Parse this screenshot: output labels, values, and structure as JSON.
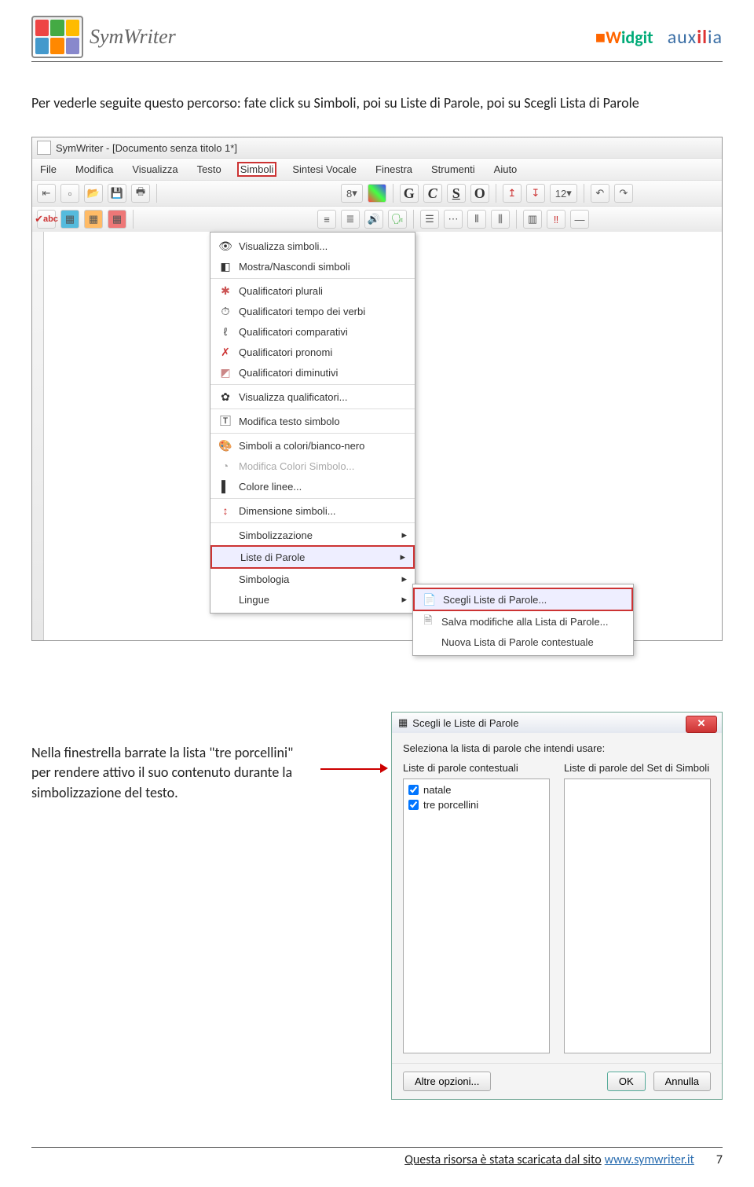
{
  "header": {
    "product_name": "SymWriter",
    "brand1_a": "W",
    "brand1_b": "idgit",
    "brand2_pre": "aux",
    "brand2_il": "il",
    "brand2_post": "ia"
  },
  "intro_text": "Per vederle seguite questo percorso: fate click su Simboli, poi su Liste di Parole, poi su Scegli Lista di Parole",
  "app": {
    "title": "SymWriter - [Documento senza titolo 1*]",
    "menus": {
      "file": "File",
      "modifica": "Modifica",
      "visualizza": "Visualizza",
      "testo": "Testo",
      "simboli": "Simboli",
      "sintesi": "Sintesi Vocale",
      "finestra": "Finestra",
      "strumenti": "Strumenti",
      "aiuto": "Aiuto"
    },
    "toolbar": {
      "fontsize": "8",
      "g": "G",
      "c": "C",
      "s": "S",
      "o": "O",
      "twelve": "12"
    },
    "dropdown": {
      "vis_simboli": "Visualizza simboli...",
      "mostra": "Mostra/Nascondi simboli",
      "plurali": "Qualificatori plurali",
      "tempo": "Qualificatori tempo dei verbi",
      "comparativi": "Qualificatori comparativi",
      "pronomi": "Qualificatori pronomi",
      "diminutivi": "Qualificatori diminutivi",
      "vis_qual": "Visualizza qualificatori...",
      "mod_testo": "Modifica testo simbolo",
      "colori_bn": "Simboli a colori/bianco-nero",
      "mod_colori": "Modifica Colori Simbolo...",
      "colore_linee": "Colore linee...",
      "dim_simboli": "Dimensione simboli...",
      "simbolizzazione": "Simbolizzazione",
      "liste_parole": "Liste di Parole",
      "simbologia": "Simbologia",
      "lingue": "Lingue"
    },
    "submenu": {
      "scegli": "Scegli Liste di Parole...",
      "salva": "Salva modifiche alla Lista di Parole...",
      "nuova": "Nuova Lista di Parole contestuale"
    }
  },
  "para2": "Nella finestrella barrate la lista \"tre porcellini\" per rendere attivo il suo contenuto durante la simbolizzazione del testo.",
  "dialog": {
    "title": "Scegli le Liste di Parole",
    "instruction": "Seleziona la lista di parole che intendi usare:",
    "col1_head": "Liste di parole contestuali",
    "col2_head": "Liste di parole del Set di Simboli",
    "item1": "natale",
    "item2": "tre porcellini",
    "altre": "Altre opzioni...",
    "ok": "OK",
    "annulla": "Annulla"
  },
  "footer": {
    "text_pre": "Questa risorsa è stata scaricata dal sito ",
    "link": "www.symwriter.it",
    "page_num": "7"
  }
}
